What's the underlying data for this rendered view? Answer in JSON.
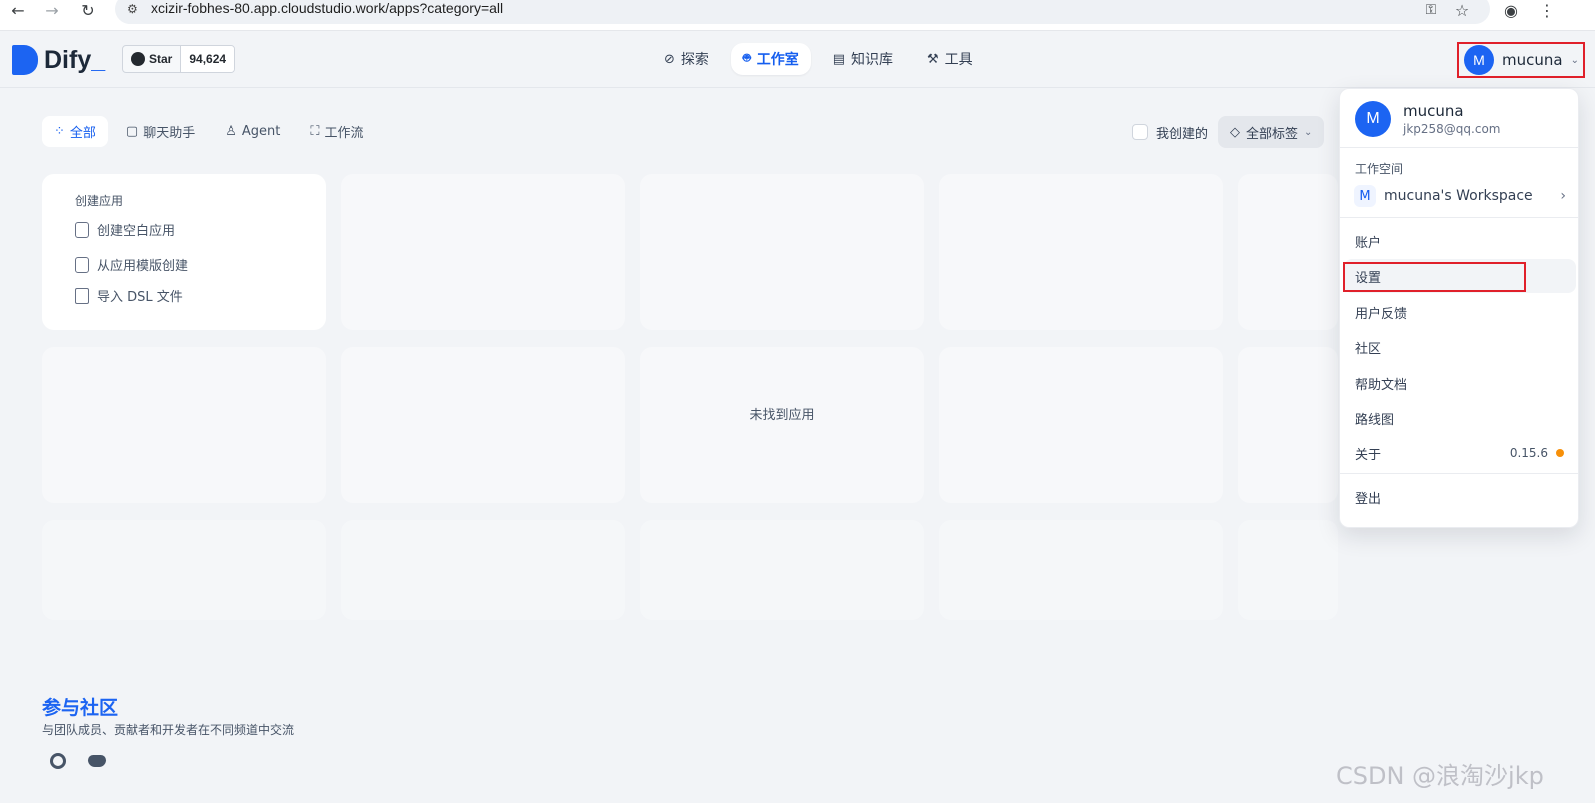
{
  "browser": {
    "url": "xcizir-fobhes-80.app.cloudstudio.work/apps?category=all"
  },
  "header": {
    "logo_text": "Dify",
    "logo_suffix": "_",
    "github_star_label": "Star",
    "github_star_count": "94,624",
    "nav": [
      {
        "label": "探索",
        "icon": "compass-icon"
      },
      {
        "label": "工作室",
        "icon": "robot-icon",
        "active": true
      },
      {
        "label": "知识库",
        "icon": "book-icon"
      },
      {
        "label": "工具",
        "icon": "hammer-icon"
      }
    ],
    "user": {
      "avatar_letter": "M",
      "name": "mucuna"
    }
  },
  "tabs": [
    {
      "label": "全部",
      "active": true
    },
    {
      "label": "聊天助手"
    },
    {
      "label": "Agent"
    },
    {
      "label": "工作流"
    }
  ],
  "filters": {
    "created_by_me": "我创建的",
    "tags": "全部标签"
  },
  "create_card": {
    "title": "创建应用",
    "items": [
      "创建空白应用",
      "从应用模版创建",
      "导入 DSL 文件"
    ]
  },
  "empty_state": "未找到应用",
  "community": {
    "title": "参与社区",
    "description": "与团队成员、贡献者和开发者在不同频道中交流"
  },
  "dropdown": {
    "avatar_letter": "M",
    "name": "mucuna",
    "email": "jkp258@qq.com",
    "workspace_label": "工作空间",
    "workspace_badge": "M",
    "workspace_name": "mucuna's Workspace",
    "items": [
      "账户",
      "设置",
      "用户反馈",
      "社区",
      "帮助文档",
      "路线图",
      "关于"
    ],
    "version": "0.15.6",
    "logout": "登出"
  },
  "watermark": "CSDN @浪淘沙jkp",
  "colors": {
    "accent": "#155eef",
    "highlight_box": "#e0202a",
    "version_dot": "#f79009"
  }
}
